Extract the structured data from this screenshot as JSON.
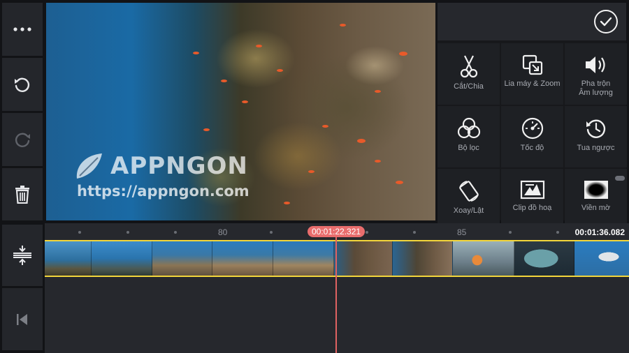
{
  "left_toolbar": {
    "items": [
      {
        "icon": "more-dots-icon",
        "enabled": true
      },
      {
        "icon": "undo-icon",
        "enabled": true
      },
      {
        "icon": "redo-icon",
        "enabled": false
      },
      {
        "icon": "trash-icon",
        "enabled": true
      },
      {
        "icon": "adjust-track-icon",
        "enabled": true
      },
      {
        "icon": "skip-to-start-icon",
        "enabled": true
      }
    ]
  },
  "preview": {
    "watermark_brand": "APPNGON",
    "watermark_url": "https://appngon.com"
  },
  "edit_panel": {
    "confirm_icon": "check-circle-icon",
    "tools": [
      {
        "label": "Cắt/Chia",
        "icon": "scissors-icon"
      },
      {
        "label": "Lia máy & Zoom",
        "icon": "pan-zoom-icon"
      },
      {
        "label": "Pha trộn\nÂm lượng",
        "icon": "volume-icon"
      },
      {
        "label": "Bộ lọc",
        "icon": "filter-circles-icon"
      },
      {
        "label": "Tốc độ",
        "icon": "speedometer-icon"
      },
      {
        "label": "Tua ngược",
        "icon": "reverse-clock-icon"
      },
      {
        "label": "Xoay/Lật",
        "icon": "rotate-phone-icon"
      },
      {
        "label": "Clip đồ hoạ",
        "icon": "graphic-clip-icon"
      },
      {
        "label": "Viền mờ",
        "icon": "vignette-icon"
      }
    ]
  },
  "timeline": {
    "tick_labels": [
      "80",
      "85"
    ],
    "playhead_time": "00:01:22.321",
    "end_time": "00:01:36.082"
  },
  "colors": {
    "accent_yellow": "#f3d63b",
    "playhead_red": "#e06262",
    "panel_bg": "#26282d"
  }
}
